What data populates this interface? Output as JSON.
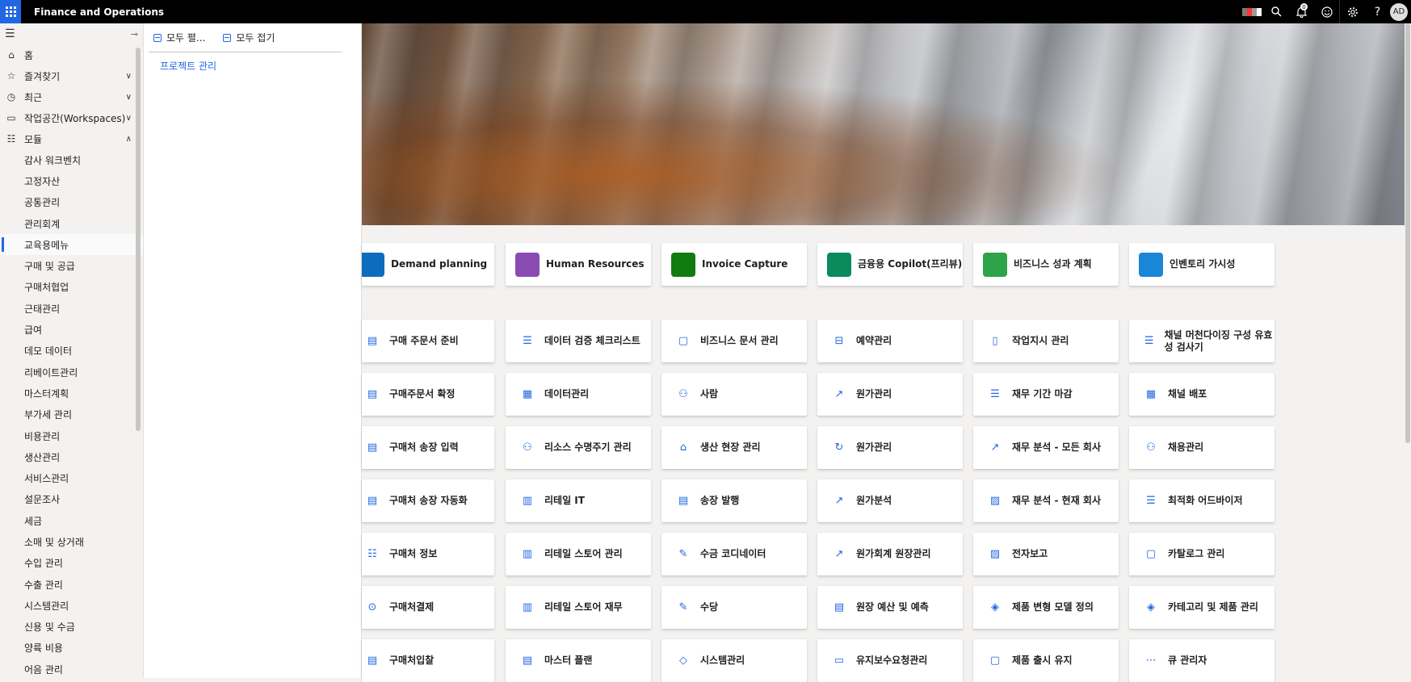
{
  "topbar": {
    "title": "Finance and Operations",
    "notification_count": "0",
    "avatar_initials": "AD"
  },
  "nav": {
    "items": [
      {
        "label": "홈",
        "icon": "home-icon"
      },
      {
        "label": "즐겨찾기",
        "icon": "star-icon"
      },
      {
        "label": "최근",
        "icon": "clock-icon"
      },
      {
        "label": "작업공간(Workspaces)",
        "icon": "workspace-icon"
      },
      {
        "label": "모듈",
        "icon": "list-icon"
      }
    ],
    "modules": [
      "감사 워크벤치",
      "고정자산",
      "공통관리",
      "관리회계",
      "교육용메뉴",
      "구매 및 공급",
      "구매처협업",
      "근태관리",
      "급여",
      "데모 데이터",
      "리베이트관리",
      "마스터계획",
      "부가세 관리",
      "비용관리",
      "생산관리",
      "서비스관리",
      "설문조사",
      "세금",
      "소매 및 상거래",
      "수입 관리",
      "수출 관리",
      "시스템관리",
      "신용 및 수금",
      "양륙 비용",
      "어음 관리"
    ],
    "selected_module": "교육용메뉴"
  },
  "flyout": {
    "expand_all": "모두 펼...",
    "collapse_all": "모두 접기",
    "links": [
      "프로젝트 관리"
    ]
  },
  "apps": [
    {
      "label": "Demand planning",
      "color": "#0f6cbd"
    },
    {
      "label": "Human Resources",
      "color": "#8a4bb3"
    },
    {
      "label": "Invoice Capture",
      "color": "#107c10"
    },
    {
      "label": "금융용 Copilot(프리뷰)",
      "color": "#0b8a5b"
    },
    {
      "label": "비즈니스 성과 계획",
      "color": "#2fa34a"
    },
    {
      "label": "인벤토리 가시성",
      "color": "#1a86d8"
    }
  ],
  "workspaces": [
    [
      "구매 주문서 준비",
      "데이터 검증 체크리스트",
      "비즈니스 문서 관리",
      "예약관리",
      "작업지시 관리",
      "채널 머천다이징 구성 유효성 검사기"
    ],
    [
      "구매주문서 확정",
      "데이터관리",
      "사람",
      "원가관리",
      "재무 기간 마감",
      "채널 배포"
    ],
    [
      "구매처 송장 입력",
      "리소스 수명주기 관리",
      "생산 현장 관리",
      "원가관리",
      "재무 분석 - 모든 회사",
      "채용관리"
    ],
    [
      "구매처 송장 자동화",
      "리테일 IT",
      "송장 발행",
      "원가분석",
      "재무 분석 - 현재 회사",
      "최적화 어드바이저"
    ],
    [
      "구매처 정보",
      "리테일 스토어 관리",
      "수금 코디네이터",
      "원가회계 원장관리",
      "전자보고",
      "카탈로그 관리"
    ],
    [
      "구매처결제",
      "리테일 스토어 재무",
      "수당",
      "원장 예산 및 예측",
      "제품 변형 모델 정의",
      "카테고리 및 제품 관리"
    ],
    [
      "구매처입찰",
      "마스터 플랜",
      "시스템관리",
      "유지보수요청관리",
      "제품 출시 유지",
      "큐 관리자"
    ]
  ],
  "workspace_icons": [
    [
      "document-icon",
      "checklist-icon",
      "document-lock-icon",
      "car-icon",
      "clipboard-icon",
      "checklist-icon"
    ],
    [
      "document-check-icon",
      "table-icon",
      "people-icon",
      "chart-up-icon",
      "checklist-icon",
      "grid-icon"
    ],
    [
      "document-edit-icon",
      "people-cycle-icon",
      "factory-icon",
      "cost-icon",
      "trend-icon",
      "person-search-icon"
    ],
    [
      "document-auto-icon",
      "store-icon",
      "invoice-icon",
      "trend-icon",
      "report-icon",
      "checklist-icon"
    ],
    [
      "person-list-icon",
      "store-icon",
      "money-icon",
      "ledger-icon",
      "report-icon",
      "catalog-icon"
    ],
    [
      "payment-icon",
      "store-icon",
      "money-icon",
      "budget-icon",
      "product-icon",
      "product-icon"
    ],
    [
      "bid-icon",
      "plan-icon",
      "shield-icon",
      "maintenance-icon",
      "box-icon",
      "queue-icon"
    ]
  ]
}
